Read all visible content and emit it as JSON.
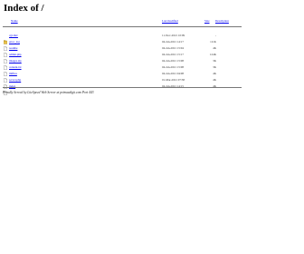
{
  "title": "Index of /",
  "headers": {
    "name": "Name",
    "last_modified": "Last modified",
    "size": "Size",
    "description": "Description"
  },
  "rows": [
    {
      "name": "cgi-bin/",
      "date": "11-Nov-2021 10:09",
      "size": "-",
      "icon": "folder-icon"
    },
    {
      "name": "error_log",
      "date": "04-Jan-2021 14:17",
      "size": "111K",
      "icon": "file-icon"
    },
    {
      "name": "readme",
      "date": "04-Jan-2021 15:04",
      "size": "4K",
      "icon": "file-icon"
    },
    {
      "name": "admin.php",
      "date": "04-Jan-2021 15:17",
      "size": "124K",
      "icon": "file-icon"
    },
    {
      "name": "images.zip",
      "date": "04-Jan-2021 15:08",
      "size": "3K",
      "icon": "file-icon"
    },
    {
      "name": "content.txt",
      "date": "04-Jan-2021 15:08",
      "size": "3K",
      "icon": "file-icon"
    },
    {
      "name": "mlfiles",
      "date": "04-Jan-2021 04:08",
      "size": "4K",
      "icon": "file-icon"
    },
    {
      "name": "server.php",
      "date": "01-Mar-2021 07:38",
      "size": "4K",
      "icon": "file-icon"
    },
    {
      "name": "index",
      "date": "04-Jan-2021 14:15",
      "size": "4K",
      "icon": "file-icon"
    }
  ],
  "footer": "Proudly Served by LiteSpeed Web Server at primaxdigit.com Port 443"
}
